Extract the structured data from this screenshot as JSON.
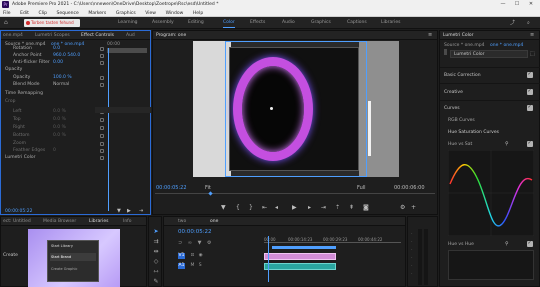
{
  "titlebar": {
    "title": "Adobe Premiere Pro 2021 - C:\\Users\\nnewen\\OneDrive\\Desktop\\Zoetrope\\Rsc\\esd\\Untitled *",
    "minimize": "—",
    "maximize": "☐",
    "close": "✕"
  },
  "menu": [
    "File",
    "Edit",
    "Clip",
    "Sequence",
    "Markers",
    "Graphics",
    "View",
    "Window",
    "Help"
  ],
  "workspaces": {
    "banner": "Torben tasten fehund",
    "tabs": [
      "Learning",
      "Assembly",
      "Editing",
      "Color",
      "Effects",
      "Audio",
      "Graphics",
      "Captions",
      "Libraries"
    ],
    "active_index": 3
  },
  "effect_controls": {
    "tabs": [
      "one.mp4",
      "Lumetri Scopes",
      "Effect Controls",
      "Aud"
    ],
    "active_tab": 2,
    "source_label": "Source * one.mp4",
    "sequence_label": "one * one.mp4",
    "timecode_ruler": "00:00",
    "rows": [
      {
        "label": "Rotation",
        "value": "0.0"
      },
      {
        "label": "Anchor Point",
        "value": "960.0   540.0"
      },
      {
        "label": "Anti-flicker Filter",
        "value": "0.00"
      },
      {
        "label": "Opacity",
        "value": ""
      },
      {
        "label": "Opacity",
        "value": "100.0 %"
      },
      {
        "label": "Blend Mode",
        "value": "Normal"
      },
      {
        "label": "Time Remapping",
        "value": ""
      },
      {
        "label": "Crop",
        "value": ""
      },
      {
        "label": "Left",
        "value": "0.0 %"
      },
      {
        "label": "Top",
        "value": "0.0 %"
      },
      {
        "label": "Right",
        "value": "0.0 %"
      },
      {
        "label": "Bottom",
        "value": "0.0 %"
      },
      {
        "label": "Zoom",
        "value": ""
      },
      {
        "label": "Feather Edges",
        "value": "0"
      },
      {
        "label": "Lumetri Color",
        "value": ""
      }
    ],
    "timecode": "00:00:05:22"
  },
  "program": {
    "tab": "Program: one",
    "timecode": "00:00:05:22",
    "fit": "Fit",
    "quality": "Full",
    "duration": "00:00:06:00"
  },
  "lumetri": {
    "tab": "Lumetri Color",
    "source": "Source * one.mp4",
    "target": "one * one.mp4",
    "effect": "Lumetri Color",
    "sections": [
      "Basic Correction",
      "Creative",
      "Curves",
      "RGB Curves",
      "Hue Saturation Curves"
    ],
    "curve_label_1": "Hue vs Sat",
    "curve_label_2": "Hue vs Hue"
  },
  "libraries": {
    "tabs": [
      "ect: Untitled",
      "Media Browser",
      "Libraries",
      "Info"
    ],
    "active_tab": 2,
    "create_label": "Create",
    "menu_items": [
      "Start Library",
      "Start Brand",
      "Create Graphic"
    ]
  },
  "timeline": {
    "tabs": [
      "two",
      "one"
    ],
    "timecode": "00:00:05:22",
    "ruler": [
      "00:00",
      "00:00:14:23",
      "00:00:29:23",
      "00:00:44:22"
    ],
    "tracks": [
      "V1",
      "A1"
    ]
  },
  "colors": {
    "accent": "#4f9fff",
    "ring": "#c44fe0",
    "audio_clip": "#2aa6a0",
    "video_clip": "#d28cd6"
  }
}
